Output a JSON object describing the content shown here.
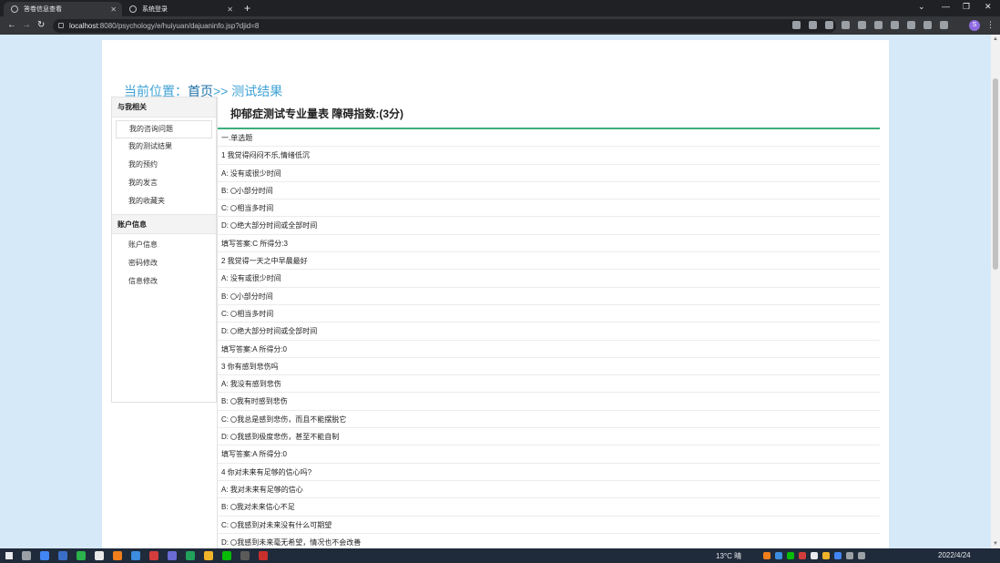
{
  "browser": {
    "tabs": [
      {
        "label": "答卷信息查看",
        "active": true
      },
      {
        "label": "系统登录",
        "active": false
      }
    ],
    "url_host": "localhost",
    "url_rest": ":8080/psychology/e/huiyuan/dajuaninfo.jsp?djid=8"
  },
  "page": {
    "breadcrumb": {
      "prefix": "当前位置：",
      "home": "首页",
      "sep_current": ">> 测试结果"
    },
    "sidebar": {
      "sections": [
        {
          "heading": "与我相关",
          "items": [
            "我的咨询问题",
            "我的测试结果",
            "我的预约",
            "我的发言",
            "我的收藏夹"
          ]
        },
        {
          "heading": "账户信息",
          "items": [
            "账户信息",
            "密码修改",
            "信息修改"
          ]
        }
      ]
    },
    "result_title": "抑郁症测试专业量表 障碍指数:(3分)",
    "rows": [
      "一.单选题",
      "1 我觉得闷闷不乐,情绪低沉",
      "A: 没有或很少时间",
      "B: ○小部分时间",
      "C: ○相当多时间",
      "D: ○绝大部分时间或全部时间",
      "填写答案:C 所得分:3",
      "2 我觉得一天之中早晨最好",
      "A: 没有或很少时间",
      "B: ○小部分时间",
      "C: ○相当多时间",
      "D: ○绝大部分时间或全部时间",
      "填写答案:A 所得分:0",
      "3 你有感到悲伤吗",
      "A: 我没有感到悲伤",
      "B: ○我有时感到悲伤",
      "C: ○我总是感到悲伤，而且不能摆脱它",
      "D: ○我感到极度悲伤，甚至不能自制",
      "填写答案:A 所得分:0",
      "4 你对未来有足够的信心吗?",
      "A: 我对未来有足够的信心",
      "B: ○我对未来信心不足",
      "C: ○我感到对未来没有什么可期望",
      "D: ○我感到未来毫无希望，情况也不会改善"
    ]
  },
  "taskbar": {
    "weather": "13°C 晴",
    "clock": "2022/4/24"
  },
  "colors": {
    "accent_green": "#3bb07b",
    "breadcrumb_blue": "#3ea2d6",
    "page_bg": "#d6e9f8"
  }
}
